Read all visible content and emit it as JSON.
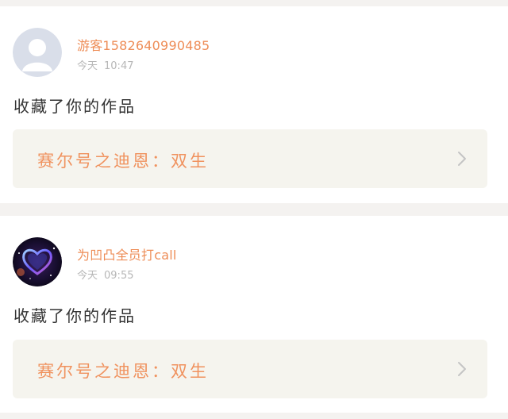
{
  "notifications": [
    {
      "username": "游客1582640990485",
      "date": "今天",
      "time": "10:47",
      "action": "收藏了你的作品",
      "work_title": "赛尔号之迪恩：双生",
      "avatar": "default-user-avatar"
    },
    {
      "username": "为凹凸全员打call",
      "date": "今天",
      "time": "09:55",
      "action": "收藏了你的作品",
      "work_title": "赛尔号之迪恩：双生",
      "avatar": "galaxy-heart-avatar"
    }
  ],
  "icons": {
    "chevron": "chevron-right-icon"
  },
  "colors": {
    "accent": "#ee8d57",
    "work_box_bg": "#f5f4ee",
    "page_bg": "#f4f2f0"
  }
}
